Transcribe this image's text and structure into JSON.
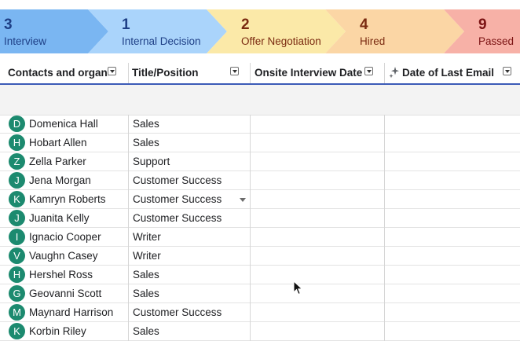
{
  "pipeline": [
    {
      "count": "3",
      "label": "Interview",
      "fill": "#7ab6f2",
      "text": "#1e3f86"
    },
    {
      "count": "1",
      "label": "Internal Decision",
      "fill": "#aad4fb",
      "text": "#1e3f86"
    },
    {
      "count": "2",
      "label": "Offer Negotiation",
      "fill": "#fbe9a8",
      "text": "#7a2a10"
    },
    {
      "count": "4",
      "label": "Hired",
      "fill": "#fbd6a5",
      "text": "#7a2a10"
    },
    {
      "count": "9",
      "label": "Passed",
      "fill": "#f7b1a7",
      "text": "#7a1212"
    }
  ],
  "columns": [
    {
      "label": "Contacts and organizatio",
      "icon": "dropdown-icon"
    },
    {
      "label": "Title/Position",
      "icon": "dropdown-icon"
    },
    {
      "label": "Onsite Interview Date",
      "icon": "dropdown-icon"
    },
    {
      "label": "Date of Last Email",
      "icon": "sparkle-icon"
    }
  ],
  "rows": [
    {
      "initial": "D",
      "name": "Domenica Hall",
      "title": "Sales"
    },
    {
      "initial": "H",
      "name": "Hobart Allen",
      "title": "Sales"
    },
    {
      "initial": "Z",
      "name": "Zella Parker",
      "title": "Support"
    },
    {
      "initial": "J",
      "name": "Jena Morgan",
      "title": "Customer Success"
    },
    {
      "initial": "K",
      "name": "Kamryn Roberts",
      "title": "Customer Success"
    },
    {
      "initial": "J",
      "name": "Juanita Kelly",
      "title": "Customer Success"
    },
    {
      "initial": "I",
      "name": "Ignacio Cooper",
      "title": "Writer"
    },
    {
      "initial": "V",
      "name": "Vaughn Casey",
      "title": "Writer"
    },
    {
      "initial": "H",
      "name": "Hershel Ross",
      "title": "Sales"
    },
    {
      "initial": "G",
      "name": "Geovanni Scott",
      "title": "Sales"
    },
    {
      "initial": "M",
      "name": "Maynard Harrison",
      "title": "Customer Success"
    },
    {
      "initial": "K",
      "name": "Korbin Riley",
      "title": "Sales"
    }
  ],
  "colors": {
    "accent": "#3c5bb7",
    "avatar": "#1c8a6f"
  }
}
